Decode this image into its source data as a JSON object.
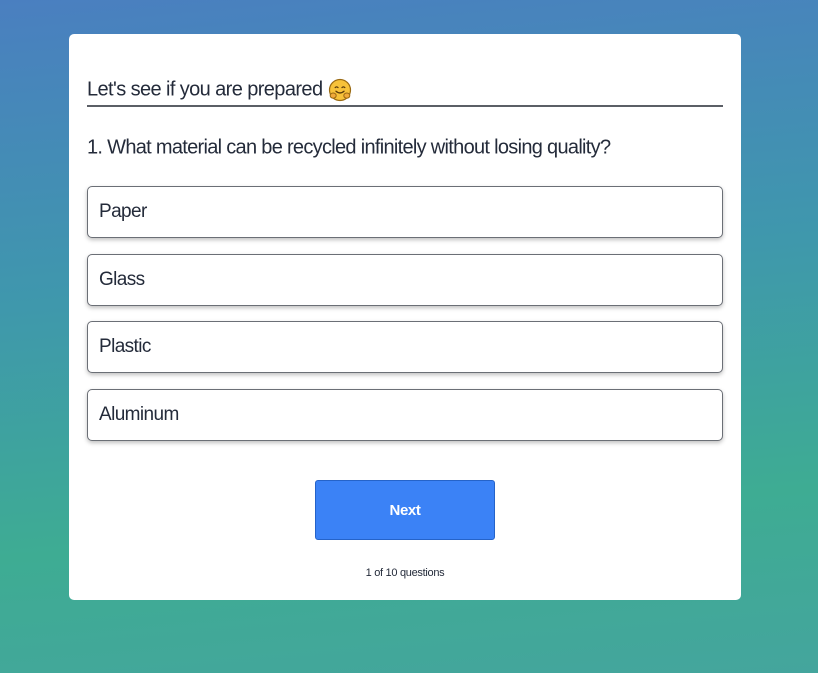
{
  "quiz": {
    "title": "Let's see if you are prepared",
    "title_emoji": "hugging-face-emoji",
    "question": "1. What material can be recycled infinitely without losing quality?",
    "options": [
      {
        "label": "Paper"
      },
      {
        "label": "Glass"
      },
      {
        "label": "Plastic"
      },
      {
        "label": "Aluminum"
      }
    ],
    "next_label": "Next",
    "progress_text": "1 of 10 questions"
  },
  "colors": {
    "background_top": "#4a7fc0",
    "background_bottom": "#3eac93",
    "card": "#ffffff",
    "button": "#3b82f6",
    "text": "#242b3a"
  }
}
